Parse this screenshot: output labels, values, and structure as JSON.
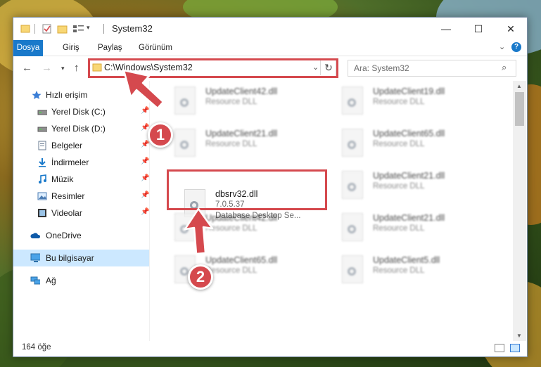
{
  "window": {
    "title": "System32",
    "controls": {
      "minimize": "—",
      "maximize": "☐",
      "close": "✕"
    }
  },
  "ribbon": {
    "tabs": [
      "Dosya",
      "Giriş",
      "Paylaş",
      "Görünüm"
    ]
  },
  "address": {
    "path": "C:\\Windows\\System32",
    "search_placeholder": "Ara: System32"
  },
  "sidebar": {
    "items": [
      {
        "label": "Hızlı erişim",
        "icon": "star-icon",
        "pinned": false
      },
      {
        "label": "Yerel Disk (C:)",
        "icon": "drive-icon",
        "pinned": true
      },
      {
        "label": "Yerel Disk (D:)",
        "icon": "drive-icon",
        "pinned": true
      },
      {
        "label": "Belgeler",
        "icon": "documents-icon",
        "pinned": true
      },
      {
        "label": "İndirmeler",
        "icon": "downloads-icon",
        "pinned": true
      },
      {
        "label": "Müzik",
        "icon": "music-icon",
        "pinned": true
      },
      {
        "label": "Resimler",
        "icon": "pictures-icon",
        "pinned": true
      },
      {
        "label": "Videolar",
        "icon": "videos-icon",
        "pinned": true
      },
      {
        "label": "OneDrive",
        "icon": "cloud-icon",
        "pinned": false
      },
      {
        "label": "Bu bilgisayar",
        "icon": "computer-icon",
        "pinned": false,
        "selected": true
      },
      {
        "label": "Ağ",
        "icon": "network-icon",
        "pinned": false
      }
    ]
  },
  "files": [
    {
      "name": "UpdateClient42.dll",
      "type": "Resource DLL"
    },
    {
      "name": "UpdateClient19.dll",
      "type": "Resource DLL"
    },
    {
      "name": "UpdateClient21.dll",
      "type": "Resource DLL"
    },
    {
      "name": "UpdateClient65.dll",
      "type": "Resource DLL"
    },
    {
      "name": "dbsrv32.dll",
      "version": "7.0.5.37",
      "type": "Database Desktop Se..."
    },
    {
      "name": "UpdateClient21.dll",
      "type": "Resource DLL"
    },
    {
      "name": "UpdateClient42.dll",
      "type": "Resource DLL"
    },
    {
      "name": "UpdateClient21.dll",
      "type": "Resource DLL"
    },
    {
      "name": "UpdateClient65.dll",
      "type": "Resource DLL"
    },
    {
      "name": "UpdateClient5.dll",
      "type": "Resource DLL"
    }
  ],
  "status": {
    "count": "164 öğe"
  },
  "annotations": {
    "step1": "1",
    "step2": "2",
    "color": "#d5494e"
  }
}
